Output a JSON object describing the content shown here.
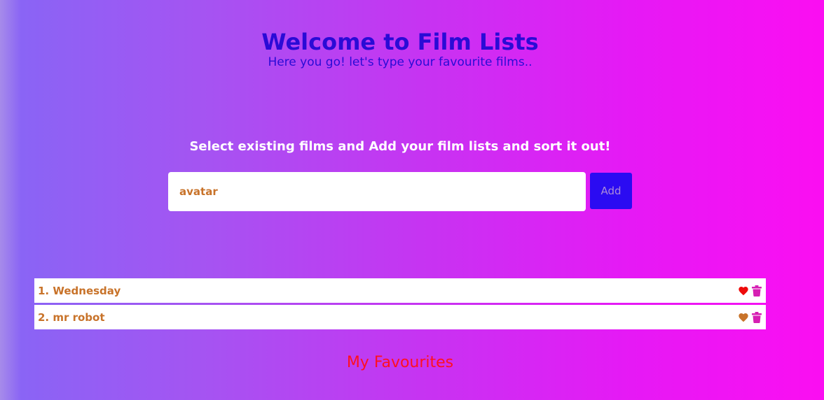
{
  "header": {
    "title": "Welcome to Film Lists",
    "subtitle": "Here you go! let's type your favourite films.."
  },
  "form": {
    "instructions": "Select existing films and Add your film lists and sort it out!",
    "input_value": "avatar",
    "add_label": "Add"
  },
  "films": [
    {
      "label": "1. Wednesday",
      "favourite": true,
      "heart_color": "#ee0b0b",
      "heart_icon": "heart-icon",
      "delete_icon": "trash-icon"
    },
    {
      "label": "2. mr robot",
      "favourite": false,
      "heart_color": "#c8732a",
      "heart_icon": "heart-icon",
      "delete_icon": "trash-icon"
    }
  ],
  "favourites": {
    "heading": "My Favourites"
  },
  "colors": {
    "title": "#2a0bd6",
    "accent_button": "#2b0bf2",
    "film_text": "#c8732a",
    "trash": "#d61fb3",
    "favourites_heading": "#ff1020"
  }
}
